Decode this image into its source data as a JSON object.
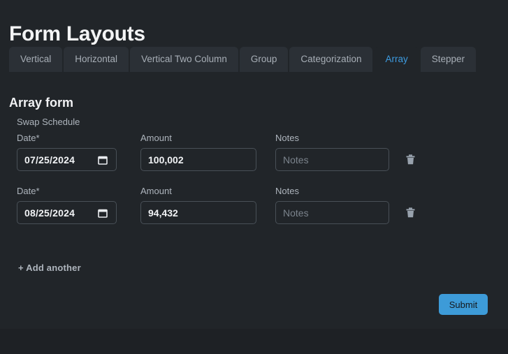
{
  "page": {
    "title": "Form Layouts",
    "background_color": "#212529",
    "accent_color": "#3d9bd8"
  },
  "tabs": [
    {
      "label": "Vertical",
      "active": false
    },
    {
      "label": "Horizontal",
      "active": false
    },
    {
      "label": "Vertical Two Column",
      "active": false
    },
    {
      "label": "Group",
      "active": false
    },
    {
      "label": "Categorization",
      "active": false
    },
    {
      "label": "Array",
      "active": true
    },
    {
      "label": "Stepper",
      "active": false
    }
  ],
  "form": {
    "heading": "Array form",
    "group_label": "Swap Schedule",
    "columns": {
      "date": "Date*",
      "amount": "Amount",
      "notes": "Notes"
    },
    "rows": [
      {
        "date_value": "07/25/2024",
        "amount_value": "100,002",
        "notes_value": "",
        "notes_placeholder": "Notes",
        "date_icon": "calendar-icon",
        "delete_icon": "trash-icon"
      },
      {
        "date_value": "08/25/2024",
        "amount_value": "94,432",
        "notes_value": "",
        "notes_placeholder": "Notes",
        "date_icon": "calendar-icon",
        "delete_icon": "trash-icon"
      }
    ],
    "add_another_label": "+ Add another",
    "submit_label": "Submit"
  }
}
